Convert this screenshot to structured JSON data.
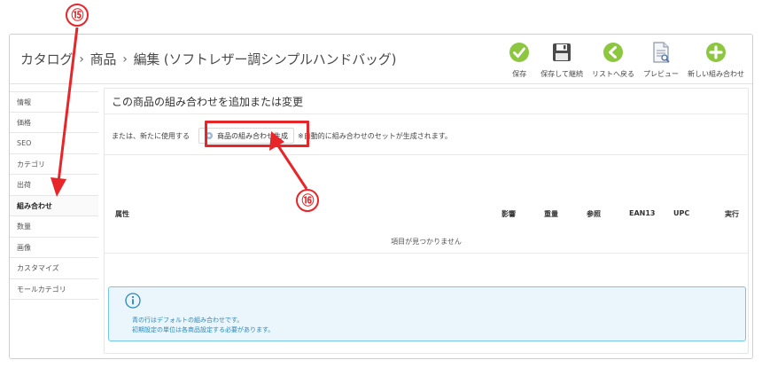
{
  "breadcrumb": {
    "root": "カタログ",
    "sep1": "›",
    "section": "商品",
    "sep2": "›",
    "current": "編集 (ソフトレザー調シンプルハンドバッグ)"
  },
  "toolbar": [
    {
      "label": "保存",
      "icon": "check-circle-icon",
      "color": "#8dc63f"
    },
    {
      "label": "保存して継続",
      "icon": "floppy-disk-icon",
      "color": "#555555"
    },
    {
      "label": "リストへ戻る",
      "icon": "arrow-left-circle-icon",
      "color": "#8dc63f"
    },
    {
      "label": "プレビュー",
      "icon": "preview-document-icon",
      "color": "#8a97a8"
    },
    {
      "label": "新しい組み合わせ",
      "icon": "plus-circle-icon",
      "color": "#8dc63f"
    }
  ],
  "sidebar": {
    "items": [
      {
        "label": "情報",
        "active": false
      },
      {
        "label": "価格",
        "active": false
      },
      {
        "label": "SEO",
        "active": false
      },
      {
        "label": "カテゴリ",
        "active": false
      },
      {
        "label": "出荷",
        "active": false
      },
      {
        "label": "組み合わせ",
        "active": true
      },
      {
        "label": "数量",
        "active": false
      },
      {
        "label": "画像",
        "active": false
      },
      {
        "label": "カスタマイズ",
        "active": false
      },
      {
        "label": "モールカテゴリ",
        "active": false
      }
    ]
  },
  "panel": {
    "title": "この商品の組み合わせを追加または変更",
    "gen_prefix": "または、新たに使用する",
    "gen_button": "商品の組み合わせ生成",
    "gen_note": "※自動的に組み合わせのセットが生成されます。",
    "columns": [
      "属性",
      "影響",
      "重量",
      "参照",
      "EAN13",
      "UPC",
      "実行"
    ],
    "empty_message": "項目が見つかりません",
    "info_line1": "青の行はデフォルトの組み合わせです。",
    "info_line2": "初期設定の単位は各商品設定する必要があります。"
  },
  "annotations": {
    "callout_15": "⑮",
    "callout_16": "⑯",
    "color": "#e8262a"
  }
}
